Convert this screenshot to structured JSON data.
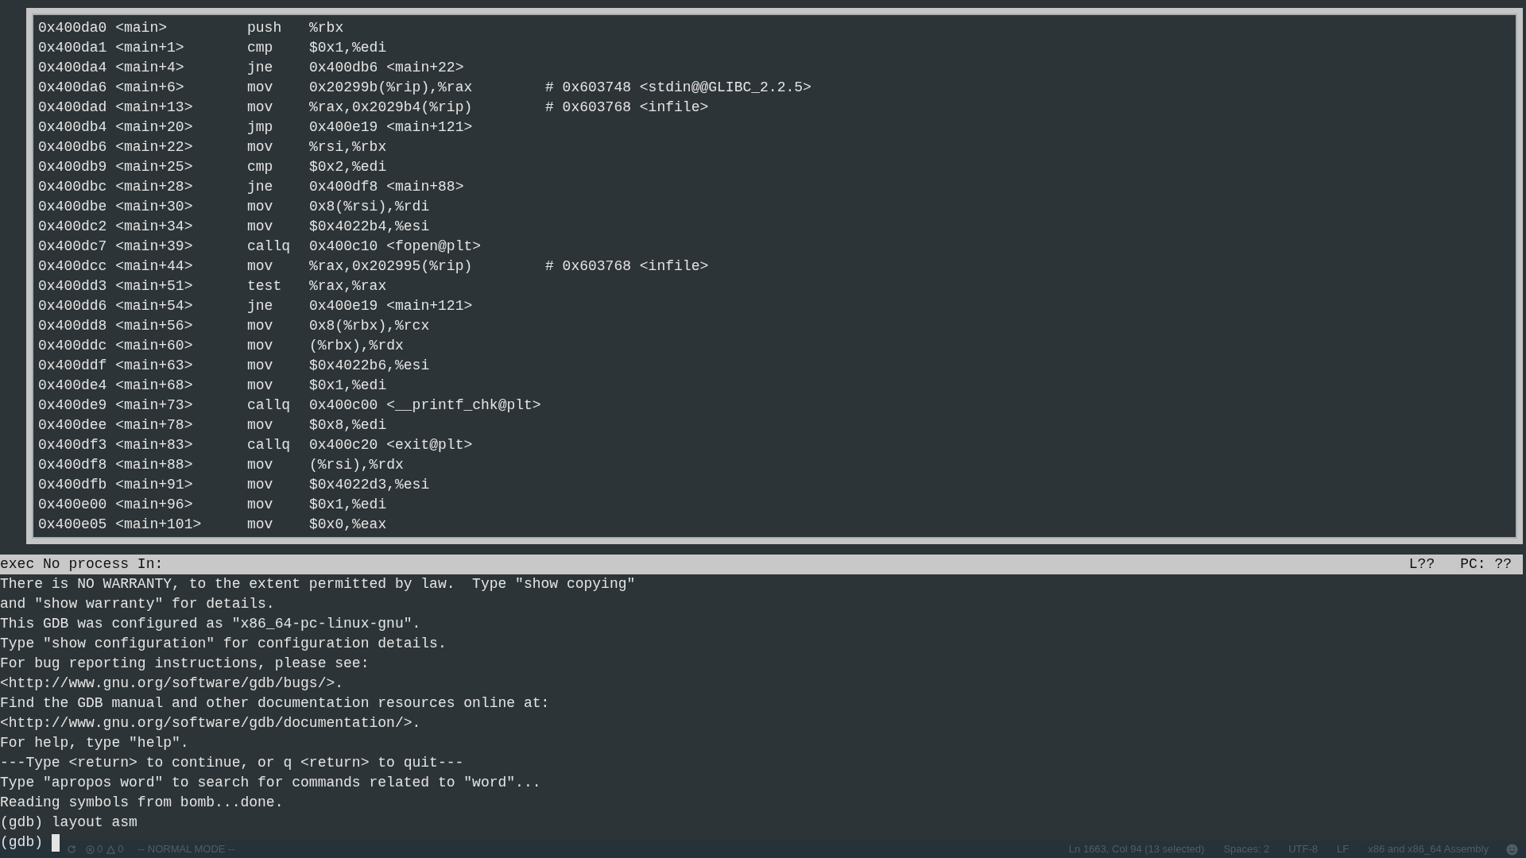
{
  "asm_window": {
    "rows": [
      {
        "address": "0x400da0 <main>",
        "mnemonic": "push",
        "operands": "%rbx"
      },
      {
        "address": "0x400da1 <main+1>",
        "mnemonic": "cmp",
        "operands": "$0x1,%edi"
      },
      {
        "address": "0x400da4 <main+4>",
        "mnemonic": "jne",
        "operands": "0x400db6 <main+22>"
      },
      {
        "address": "0x400da6 <main+6>",
        "mnemonic": "mov",
        "operands": "0x20299b(%rip),%rax",
        "comment": "# 0x603748 <stdin@@GLIBC_2.2.5>"
      },
      {
        "address": "0x400dad <main+13>",
        "mnemonic": "mov",
        "operands": "%rax,0x2029b4(%rip)",
        "comment": "# 0x603768 <infile>"
      },
      {
        "address": "0x400db4 <main+20>",
        "mnemonic": "jmp",
        "operands": "0x400e19 <main+121>"
      },
      {
        "address": "0x400db6 <main+22>",
        "mnemonic": "mov",
        "operands": "%rsi,%rbx"
      },
      {
        "address": "0x400db9 <main+25>",
        "mnemonic": "cmp",
        "operands": "$0x2,%edi"
      },
      {
        "address": "0x400dbc <main+28>",
        "mnemonic": "jne",
        "operands": "0x400df8 <main+88>"
      },
      {
        "address": "0x400dbe <main+30>",
        "mnemonic": "mov",
        "operands": "0x8(%rsi),%rdi"
      },
      {
        "address": "0x400dc2 <main+34>",
        "mnemonic": "mov",
        "operands": "$0x4022b4,%esi"
      },
      {
        "address": "0x400dc7 <main+39>",
        "mnemonic": "callq",
        "operands": "0x400c10 <fopen@plt>"
      },
      {
        "address": "0x400dcc <main+44>",
        "mnemonic": "mov",
        "operands": "%rax,0x202995(%rip)",
        "comment": "# 0x603768 <infile>"
      },
      {
        "address": "0x400dd3 <main+51>",
        "mnemonic": "test",
        "operands": "%rax,%rax"
      },
      {
        "address": "0x400dd6 <main+54>",
        "mnemonic": "jne",
        "operands": "0x400e19 <main+121>"
      },
      {
        "address": "0x400dd8 <main+56>",
        "mnemonic": "mov",
        "operands": "0x8(%rbx),%rcx"
      },
      {
        "address": "0x400ddc <main+60>",
        "mnemonic": "mov",
        "operands": "(%rbx),%rdx"
      },
      {
        "address": "0x400ddf <main+63>",
        "mnemonic": "mov",
        "operands": "$0x4022b6,%esi"
      },
      {
        "address": "0x400de4 <main+68>",
        "mnemonic": "mov",
        "operands": "$0x1,%edi"
      },
      {
        "address": "0x400de9 <main+73>",
        "mnemonic": "callq",
        "operands": "0x400c00 <__printf_chk@plt>"
      },
      {
        "address": "0x400dee <main+78>",
        "mnemonic": "mov",
        "operands": "$0x8,%edi"
      },
      {
        "address": "0x400df3 <main+83>",
        "mnemonic": "callq",
        "operands": "0x400c20 <exit@plt>"
      },
      {
        "address": "0x400df8 <main+88>",
        "mnemonic": "mov",
        "operands": "(%rsi),%rdx"
      },
      {
        "address": "0x400dfb <main+91>",
        "mnemonic": "mov",
        "operands": "$0x4022d3,%esi"
      },
      {
        "address": "0x400e00 <main+96>",
        "mnemonic": "mov",
        "operands": "$0x1,%edi"
      },
      {
        "address": "0x400e05 <main+101>",
        "mnemonic": "mov",
        "operands": "$0x0,%eax"
      }
    ]
  },
  "status_line": {
    "left": "exec No process In:",
    "line": "L??",
    "pc": "PC: ??"
  },
  "console": {
    "lines": [
      "There is NO WARRANTY, to the extent permitted by law.  Type \"show copying\"",
      "and \"show warranty\" for details.",
      "This GDB was configured as \"x86_64-pc-linux-gnu\".",
      "Type \"show configuration\" for configuration details.",
      "For bug reporting instructions, please see:",
      "<http://www.gnu.org/software/gdb/bugs/>.",
      "Find the GDB manual and other documentation resources online at:",
      "<http://www.gnu.org/software/gdb/documentation/>.",
      "For help, type \"help\".",
      "---Type <return> to continue, or q <return> to quit---",
      "Type \"apropos word\" to search for commands related to \"word\"...",
      "Reading symbols from bomb...done.",
      "(gdb) layout asm"
    ],
    "prompt": "(gdb)"
  },
  "editor_status_bar": {
    "errors": "0",
    "warnings": "0",
    "mode": "-- NORMAL MODE --",
    "right": [
      "Ln 1663, Col 94 (13 selected)",
      "Spaces: 2",
      "UTF-8",
      "LF",
      "x86 and x86_64 Assembly"
    ]
  }
}
